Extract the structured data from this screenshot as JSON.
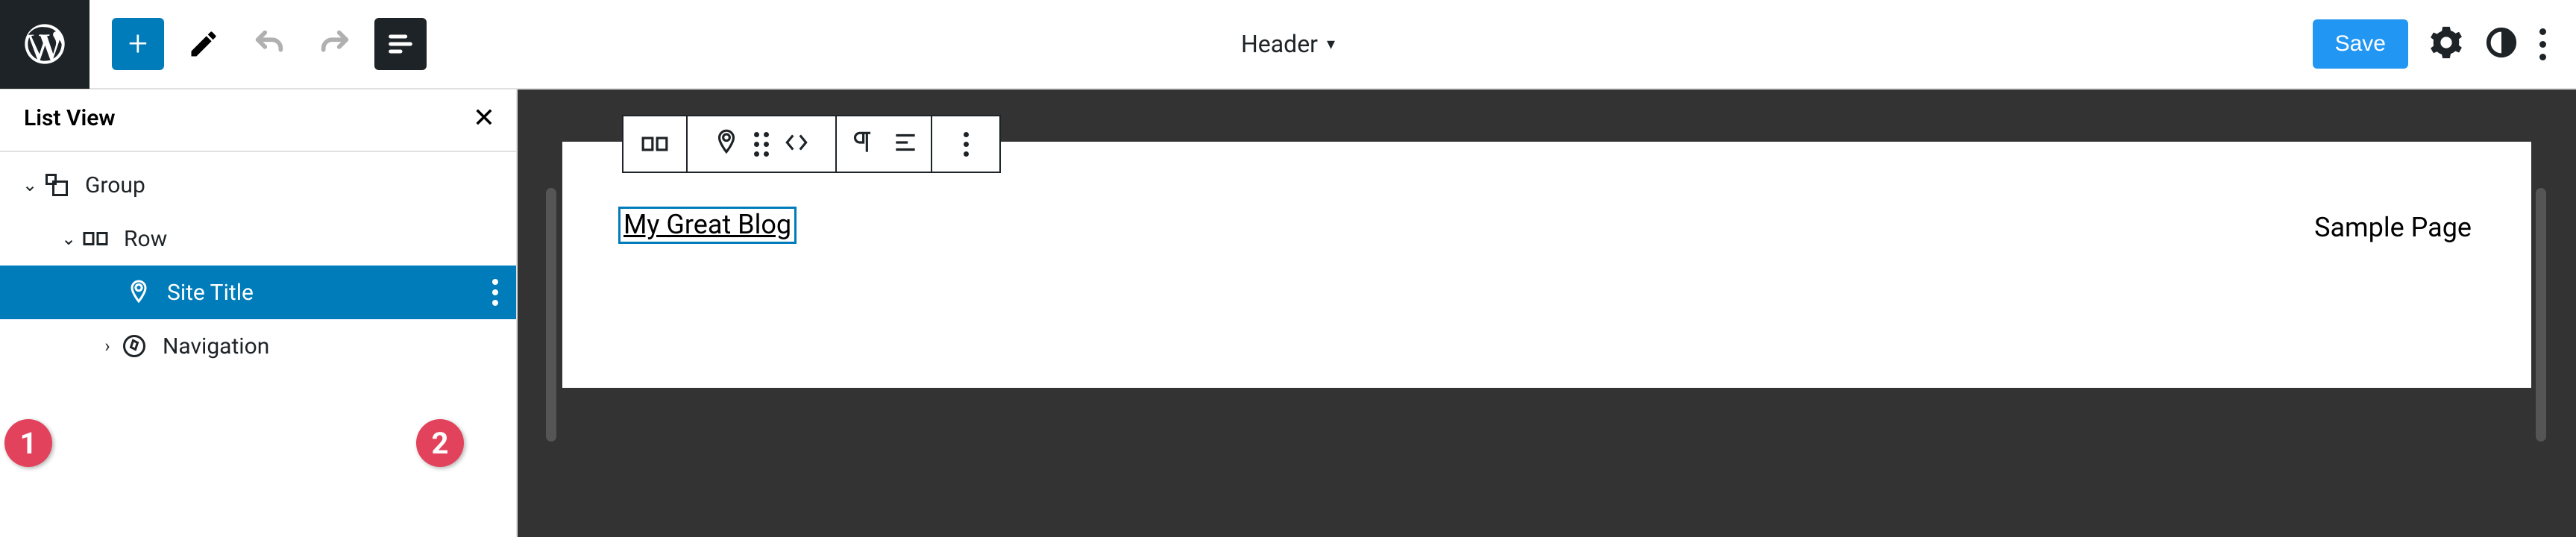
{
  "topbar": {
    "document_title": "Header",
    "save_label": "Save"
  },
  "sidebar": {
    "title": "List View",
    "rows": [
      {
        "label": "Group",
        "depth": 0,
        "expandable": true,
        "expanded": true,
        "icon": "group",
        "selected": false
      },
      {
        "label": "Row",
        "depth": 1,
        "expandable": true,
        "expanded": true,
        "icon": "row",
        "selected": false
      },
      {
        "label": "Site Title",
        "depth": 2,
        "expandable": false,
        "expanded": false,
        "icon": "pin",
        "selected": true
      },
      {
        "label": "Navigation",
        "depth": 2,
        "expandable": true,
        "expanded": false,
        "icon": "compass",
        "selected": false
      }
    ]
  },
  "annotations": {
    "badge1": "1",
    "badge2": "2"
  },
  "canvas": {
    "site_title": "My Great Blog",
    "nav_item": "Sample Page"
  }
}
